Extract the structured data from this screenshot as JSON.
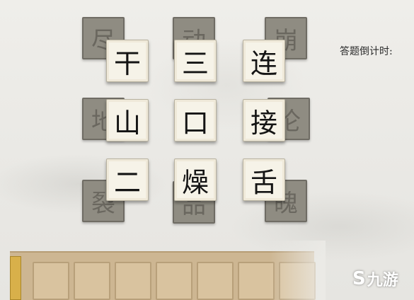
{
  "board": {
    "back_tiles": [
      "尽",
      "动",
      "崩",
      "地",
      "伦",
      "裂",
      "品",
      "魄"
    ],
    "front_tiles": [
      "干",
      "三",
      "连",
      "山",
      "口",
      "接",
      "二",
      "燥",
      "舌"
    ]
  },
  "hud": {
    "countdown_label": "答题倒计时:"
  },
  "watermark": {
    "logo_glyph": "S",
    "text": "九游"
  }
}
